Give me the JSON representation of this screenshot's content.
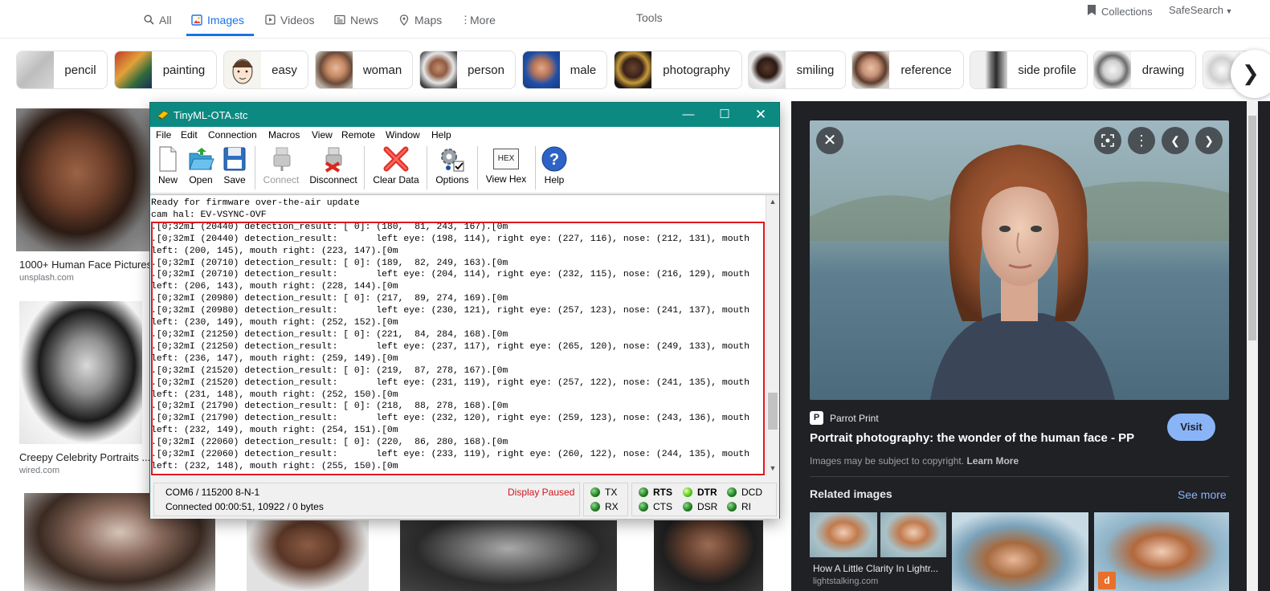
{
  "google_nav": {
    "tabs": [
      {
        "label": "All",
        "icon": "search-icon"
      },
      {
        "label": "Images",
        "icon": "image-icon"
      },
      {
        "label": "Videos",
        "icon": "video-icon"
      },
      {
        "label": "News",
        "icon": "news-icon"
      },
      {
        "label": "Maps",
        "icon": "map-pin-icon"
      },
      {
        "label": "More",
        "icon": "more-vert-icon"
      }
    ],
    "active_tab": "Images",
    "tools": "Tools",
    "collections": "Collections",
    "safesearch": "SafeSearch"
  },
  "chips": [
    "pencil",
    "painting",
    "easy",
    "woman",
    "person",
    "male",
    "photography",
    "smiling",
    "reference",
    "side profile",
    "drawing"
  ],
  "results": [
    {
      "title": "1000+ Human Face Pictures |",
      "source": "unsplash.com"
    },
    {
      "title": "Creepy Celebrity Portraits ...",
      "source": "wired.com"
    }
  ],
  "preview": {
    "source_name": "Parrot Print",
    "title": "Portrait photography: the wonder of the human face - PP",
    "copyright_text": "Images may be subject to copyright.",
    "learn_more": "Learn More",
    "visit": "Visit",
    "related_title": "Related images",
    "see_more": "See more",
    "related_caption": "How A Little Clarity In Lightr...",
    "related_source": "lightstalking.com"
  },
  "terminal": {
    "title": "TinyML-OTA.stc",
    "menus": [
      "File",
      "Edit",
      "Connection",
      "Macros",
      "View",
      "Remote",
      "Window",
      "Help"
    ],
    "toolbar": {
      "new": "New",
      "open": "Open",
      "save": "Save",
      "connect": "Connect",
      "disconnect": "Disconnect",
      "clear": "Clear Data",
      "options": "Options",
      "view_hex": "View Hex",
      "hex_icon_text": "HEX",
      "help": "Help"
    },
    "console_lines": [
      "Ready for firmware over-the-air update",
      "cam hal: EV-VSYNC-OVF",
      ".[0;32mI (20440) detection_result: [ 0]: (180,  81, 243, 167).[0m",
      ".[0;32mI (20440) detection_result:       left eye: (198, 114), right eye: (227, 116), nose: (212, 131), mouth",
      "left: (200, 145), mouth right: (223, 147).[0m",
      ".[0;32mI (20710) detection_result: [ 0]: (189,  82, 249, 163).[0m",
      ".[0;32mI (20710) detection_result:       left eye: (204, 114), right eye: (232, 115), nose: (216, 129), mouth",
      "left: (206, 143), mouth right: (228, 144).[0m",
      ".[0;32mI (20980) detection_result: [ 0]: (217,  89, 274, 169).[0m",
      ".[0;32mI (20980) detection_result:       left eye: (230, 121), right eye: (257, 123), nose: (241, 137), mouth",
      "left: (230, 149), mouth right: (252, 152).[0m",
      ".[0;32mI (21250) detection_result: [ 0]: (221,  84, 284, 168).[0m",
      ".[0;32mI (21250) detection_result:       left eye: (237, 117), right eye: (265, 120), nose: (249, 133), mouth",
      "left: (236, 147), mouth right: (259, 149).[0m",
      ".[0;32mI (21520) detection_result: [ 0]: (219,  87, 278, 167).[0m",
      ".[0;32mI (21520) detection_result:       left eye: (231, 119), right eye: (257, 122), nose: (241, 135), mouth",
      "left: (231, 148), mouth right: (252, 150).[0m",
      ".[0;32mI (21790) detection_result: [ 0]: (218,  88, 278, 168).[0m",
      ".[0;32mI (21790) detection_result:       left eye: (232, 120), right eye: (259, 123), nose: (243, 136), mouth",
      "left: (232, 149), mouth right: (254, 151).[0m",
      ".[0;32mI (22060) detection_result: [ 0]: (220,  86, 280, 168).[0m",
      ".[0;32mI (22060) detection_result:       left eye: (233, 119), right eye: (260, 122), nose: (244, 135), mouth",
      "left: (232, 148), mouth right: (255, 150).[0m"
    ],
    "status": {
      "port": "COM6 / 115200 8-N-1",
      "connection": "Connected 00:00:51, 10922 / 0 bytes",
      "paused": "Display Paused",
      "signals": {
        "tx": "TX",
        "rx": "RX",
        "rts": "RTS",
        "cts": "CTS",
        "dtr": "DTR",
        "dsr": "DSR",
        "dcd": "DCD",
        "ri": "RI"
      }
    }
  },
  "colors": {
    "google_blue": "#1a73e8",
    "titlebar_teal": "#0c8a82",
    "highlight_red": "#e0141e",
    "paused_red": "#d0161c",
    "preview_bg": "#202124",
    "visit_button": "#8ab4f8"
  }
}
